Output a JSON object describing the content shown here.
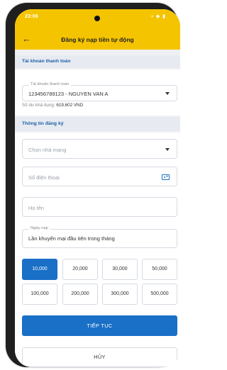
{
  "status_bar": {
    "time": "23:06",
    "icons": "▪ ◆ ▮"
  },
  "header": {
    "title": "Đăng ký nạp tiền tự động",
    "back_icon": "back-arrow-icon"
  },
  "payment_section": {
    "title": "Tài khoản thanh toán",
    "account_label": "Tài khoản thanh toán",
    "account_value": "123456789123 - NGUYEN VAN A",
    "balance_label": "Số dư khả dụng:",
    "balance_value": "619,602 VND"
  },
  "registration_section": {
    "title": "Thông tin đăng ký",
    "carrier_placeholder": "Chọn nhà mạng",
    "phone_placeholder": "Số điện thoại",
    "name_placeholder": "Họ tên",
    "date_label": "Ngày nạp",
    "date_value": "Lần khuyến mại đầu tiên trong tháng"
  },
  "amounts": [
    "10,000",
    "20,000",
    "30,000",
    "50,000",
    "100,000",
    "200,000",
    "300,000",
    "500,000"
  ],
  "selected_amount": "10,000",
  "buttons": {
    "continue": "TIẾP TỤC",
    "cancel": "HỦY"
  },
  "colors": {
    "header": "#f5c400",
    "primary": "#1a6fc7",
    "section_title": "#1a5da6"
  }
}
